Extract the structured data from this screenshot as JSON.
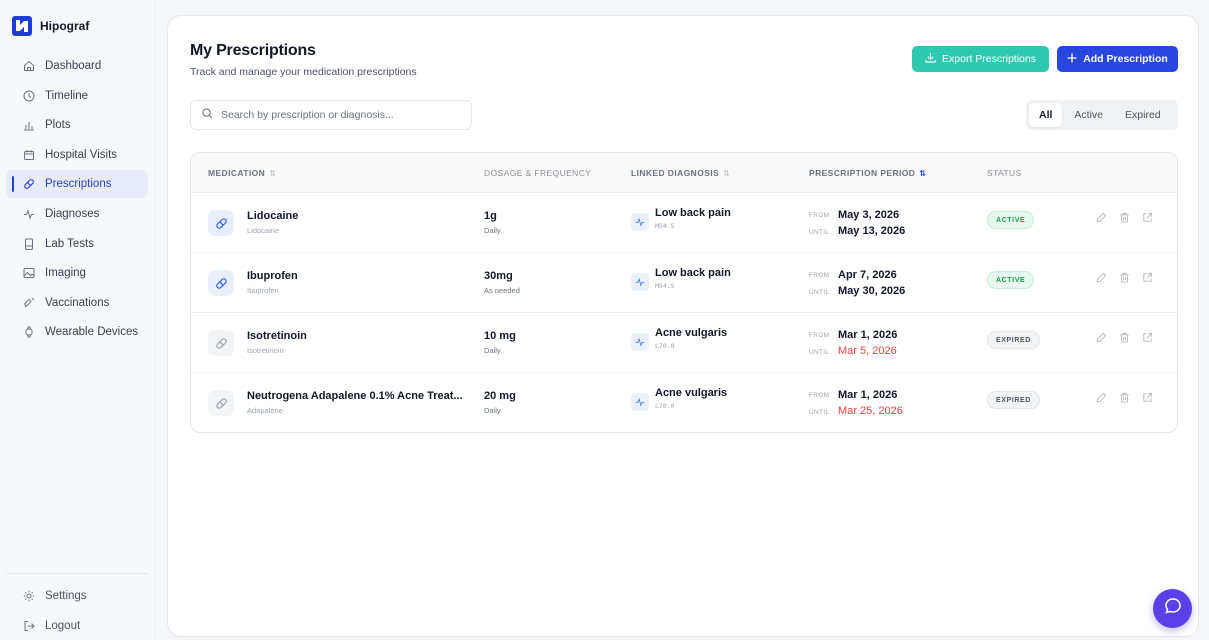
{
  "brand": {
    "name": "Hipograf"
  },
  "sidebar": {
    "items": [
      {
        "label": "Dashboard",
        "icon": "home-icon"
      },
      {
        "label": "Timeline",
        "icon": "clock-icon"
      },
      {
        "label": "Plots",
        "icon": "bar-chart-icon"
      },
      {
        "label": "Hospital Visits",
        "icon": "calendar-icon"
      },
      {
        "label": "Prescriptions",
        "icon": "pill-icon",
        "active": true
      },
      {
        "label": "Diagnoses",
        "icon": "activity-icon"
      },
      {
        "label": "Lab Tests",
        "icon": "test-tube-icon"
      },
      {
        "label": "Imaging",
        "icon": "image-icon"
      },
      {
        "label": "Vaccinations",
        "icon": "syringe-icon"
      },
      {
        "label": "Wearable Devices",
        "icon": "watch-icon"
      }
    ],
    "bottom": [
      {
        "label": "Settings",
        "icon": "gear-icon"
      },
      {
        "label": "Logout",
        "icon": "logout-icon"
      }
    ]
  },
  "header": {
    "title": "My Prescriptions",
    "subtitle": "Track and manage your medication prescriptions",
    "export_label": "Export Prescriptions",
    "add_label": "Add Prescription"
  },
  "search": {
    "placeholder": "Search by prescription or diagnosis..."
  },
  "filters": [
    "All",
    "Active",
    "Expired"
  ],
  "table": {
    "columns": [
      "MEDICATION",
      "DOSAGE & FREQUENCY",
      "LINKED DIAGNOSIS",
      "PRESCRIPTION PERIOD",
      "STATUS"
    ],
    "from_label": "FROM",
    "until_label": "UNTIL",
    "rows": [
      {
        "name": "Lidocaine",
        "generic": "Lidocaine",
        "dose": "1g",
        "frequency": "Daily",
        "diagnosis": "Low back pain",
        "code": "M54.5",
        "from": "May 3, 2026",
        "until": "May 13, 2026",
        "status": "ACTIVE"
      },
      {
        "name": "Ibuprofen",
        "generic": "Ibuprofen",
        "dose": "30mg",
        "frequency": "As needed",
        "diagnosis": "Low back pain",
        "code": "M54.5",
        "from": "Apr 7, 2026",
        "until": "May 30, 2026",
        "status": "ACTIVE"
      },
      {
        "name": "Isotretinoin",
        "generic": "Isotretinoin",
        "dose": "10 mg",
        "frequency": "Daily",
        "diagnosis": "Acne vulgaris",
        "code": "L70.0",
        "from": "Mar 1, 2026",
        "until": "Mar 5, 2026",
        "status": "EXPIRED"
      },
      {
        "name": "Neutrogena Adapalene 0.1% Acne Treat...",
        "generic": "Adapalene",
        "dose": "20 mg",
        "frequency": "Daily",
        "diagnosis": "Acne vulgaris",
        "code": "L70.0",
        "from": "Mar 1, 2026",
        "until": "Mar 25, 2026",
        "status": "EXPIRED"
      }
    ]
  },
  "colors": {
    "primary": "#2747e0",
    "teal": "#2fc9b2",
    "chat": "#5b40e8",
    "expired_text": "#ef4444",
    "active_badge": "#16a34a"
  }
}
